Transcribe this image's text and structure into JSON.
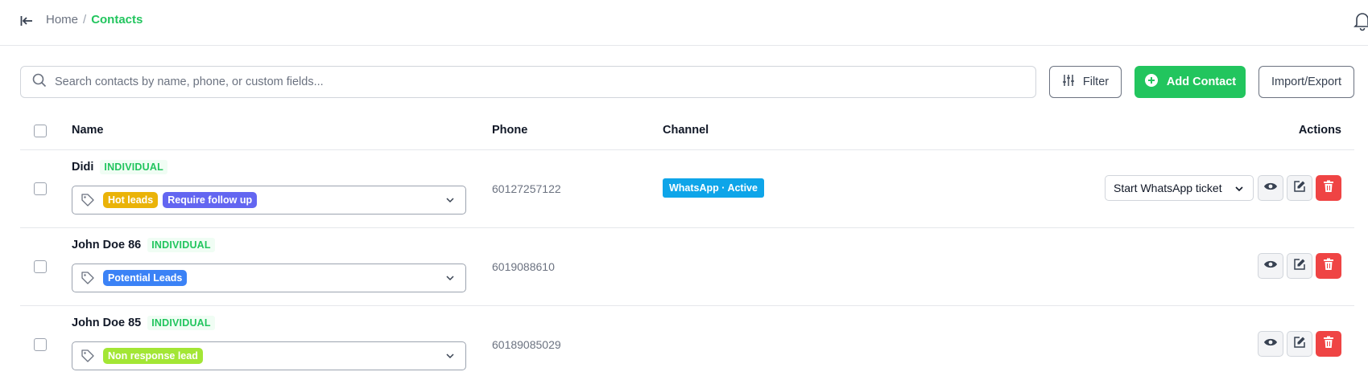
{
  "breadcrumb": {
    "home": "Home",
    "separator": "/",
    "current": "Contacts"
  },
  "search": {
    "placeholder": "Search contacts by name, phone, or custom fields...",
    "value": ""
  },
  "toolbar": {
    "filter_label": "Filter",
    "add_label": "Add Contact",
    "import_export_label": "Import/Export"
  },
  "table": {
    "headers": {
      "name": "Name",
      "phone": "Phone",
      "channel": "Channel",
      "actions": "Actions"
    },
    "rows": [
      {
        "name": "Didi",
        "type": "INDIVIDUAL",
        "tags": [
          {
            "label": "Hot leads",
            "color": "#eab308"
          },
          {
            "label": "Require follow up",
            "color": "#6366f1"
          }
        ],
        "phone": "60127257122",
        "channel": "WhatsApp · Active",
        "ticket_action": "Start WhatsApp ticket"
      },
      {
        "name": "John Doe 86",
        "type": "INDIVIDUAL",
        "tags": [
          {
            "label": "Potential Leads",
            "color": "#3b82f6"
          }
        ],
        "phone": "6019088610",
        "channel": "",
        "ticket_action": ""
      },
      {
        "name": "John Doe 85",
        "type": "INDIVIDUAL",
        "tags": [
          {
            "label": "Non response lead",
            "color": "#a3e635"
          }
        ],
        "phone": "60189085029",
        "channel": "",
        "ticket_action": ""
      }
    ]
  },
  "colors": {
    "accent": "#22c55e",
    "channel": "#0ea5e9",
    "danger": "#ef4444"
  },
  "icons": {
    "collapse": "collapse-sidebar-icon",
    "bell": "bell-icon",
    "search": "search-icon",
    "filter": "sliders-icon",
    "add": "plus-circle-icon",
    "tag": "tag-icon",
    "chevron": "chevron-down-icon",
    "view": "eye-icon",
    "edit": "edit-icon",
    "delete": "trash-icon"
  }
}
